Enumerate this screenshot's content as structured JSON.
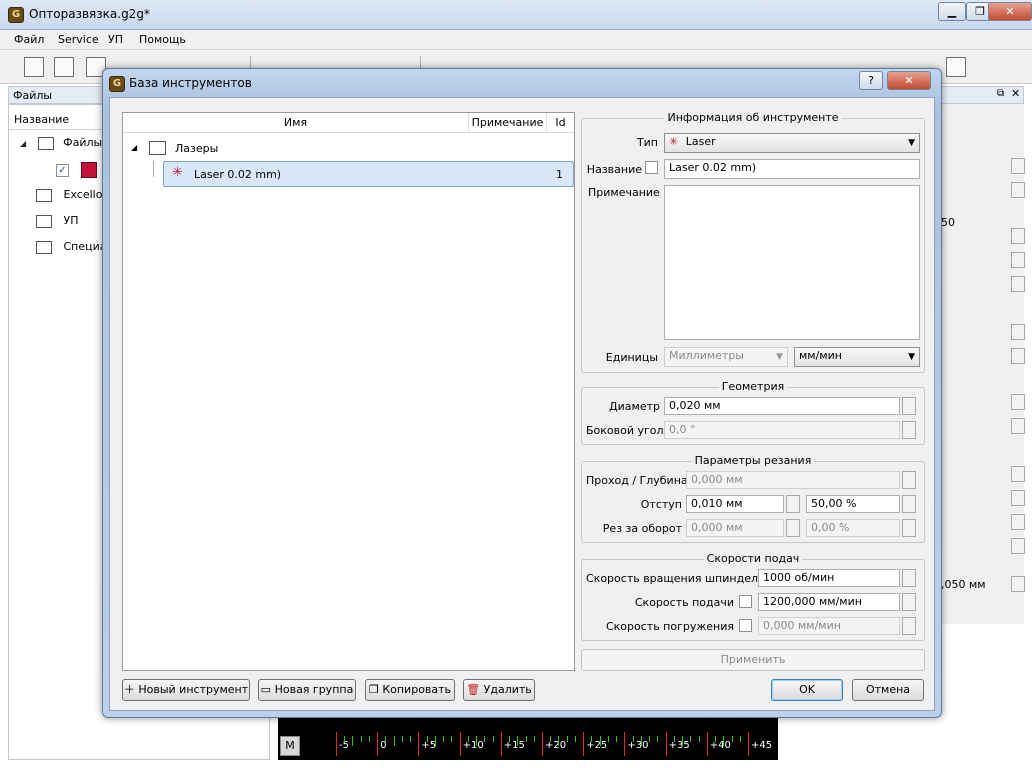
{
  "app": {
    "title": "Опторазвязка.g2g*",
    "menu": [
      "Файл",
      "Service",
      "УП",
      "Помощь"
    ],
    "win_buttons": [
      "▁",
      "❐",
      "✕"
    ]
  },
  "left_dock": {
    "title": "Файлы",
    "column": "Название",
    "items": [
      {
        "label": "Файлы"
      },
      {
        "label": "Excellon"
      },
      {
        "label": "УП"
      },
      {
        "label": "Специа"
      }
    ]
  },
  "right_dock": {
    "fragments": [
      "50",
      ",050 мм"
    ]
  },
  "ruler": {
    "mode_button": "M",
    "ticks": [
      "-5",
      "0",
      "+5",
      "+10",
      "+15",
      "+20",
      "+25",
      "+30",
      "+35",
      "+40",
      "+45"
    ]
  },
  "dialog": {
    "title": "База инструментов",
    "help_button": "?",
    "close_button": "✕",
    "tree": {
      "columns": [
        "Имя",
        "Примечание",
        "Id"
      ],
      "group": "Лазеры",
      "tool": {
        "name": "Laser 0.02 mm)",
        "id": "1"
      }
    },
    "info": {
      "title": "Информация об инструменте",
      "type_label": "Тип",
      "type_value": "Laser",
      "name_label": "Название",
      "name_value": "Laser 0.02 mm)",
      "note_label": "Примечание",
      "units_label": "Единицы",
      "units_value": "Миллиметры",
      "feed_units_value": "мм/мин"
    },
    "geometry": {
      "title": "Геометрия",
      "diameter_label": "Диаметр",
      "diameter_value": "0,020 мм",
      "side_angle_label": "Боковой угол",
      "side_angle_value": "0,0 °"
    },
    "cutting": {
      "title": "Параметры резания",
      "pass_label": "Проход / Глубина",
      "pass_value": "0,000 мм",
      "offset_label": "Отступ",
      "offset_value": "0,010 мм",
      "offset_percent": "50,00 %",
      "per_rev_label": "Рез за оборот",
      "per_rev_value": "0,000 мм",
      "per_rev_percent": "0,00 %"
    },
    "feeds": {
      "title": "Скорости подач",
      "spindle_label": "Скорость вращения шпинделя",
      "spindle_value": "1000 об/мин",
      "feed_label": "Скорость подачи",
      "feed_value": "1200,000 мм/мин",
      "plunge_label": "Скорость погружения",
      "plunge_value": "0,000 мм/мин"
    },
    "apply_button": "Применить",
    "new_tool_button": "Новый инструмент",
    "new_group_button": "Новая группа",
    "copy_button": "Копировать",
    "delete_button": "Удалить",
    "ok_button": "OK",
    "cancel_button": "Отмена"
  },
  "colors": {
    "selection": "#d8e8f8",
    "laser_red": "#c4143c",
    "ruler_bg": "#000000"
  }
}
